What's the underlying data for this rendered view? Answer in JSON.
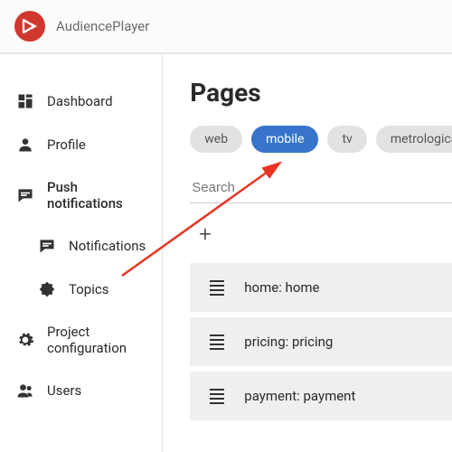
{
  "brand": {
    "name": "AudiencePlayer"
  },
  "sidebar": {
    "items": [
      {
        "label": "Dashboard",
        "icon": "dashboard-icon"
      },
      {
        "label": "Profile",
        "icon": "profile-icon"
      },
      {
        "label": "Push notifications",
        "icon": "push-icon"
      },
      {
        "label": "Notifications",
        "icon": "chat-icon",
        "sub": true
      },
      {
        "label": "Topics",
        "icon": "star-badge-icon",
        "sub": true
      },
      {
        "label": "Project configuration",
        "icon": "gear-icon"
      },
      {
        "label": "Users",
        "icon": "users-icon"
      }
    ]
  },
  "pages": {
    "title": "Pages",
    "filters": [
      "web",
      "mobile",
      "tv",
      "metrological"
    ],
    "active_filter": 1,
    "search_placeholder": "Search",
    "items": [
      {
        "label": "home: home"
      },
      {
        "label": "pricing: pricing"
      },
      {
        "label": "payment: payment"
      }
    ]
  }
}
